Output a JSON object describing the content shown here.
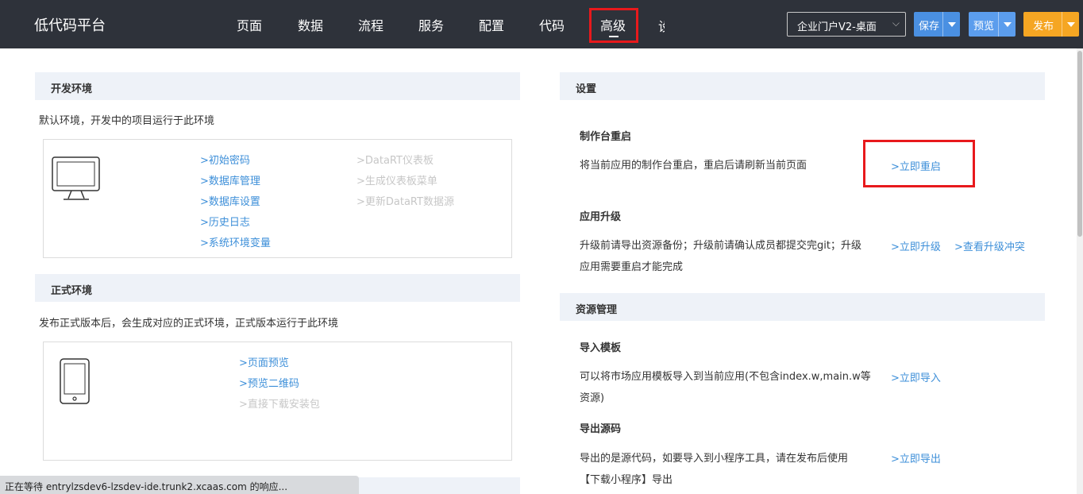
{
  "header": {
    "brand": "低代码平台",
    "nav": [
      "页面",
      "数据",
      "流程",
      "服务",
      "配置",
      "代码",
      "高级"
    ],
    "nav_trunc": "设",
    "env_select": "企业门户V2-桌面",
    "save_label": "保存",
    "preview_label": "预览",
    "publish_label": "发布"
  },
  "dev_env": {
    "title": "开发环境",
    "desc": "默认环境，开发中的项目运行于此环境",
    "links_left": [
      ">初始密码",
      ">数据库管理",
      ">数据库设置",
      ">历史日志",
      ">系统环境变量"
    ],
    "links_right": [
      ">DataRT仪表板",
      ">生成仪表板菜单",
      ">更新DataRT数据源"
    ]
  },
  "prod_env": {
    "title": "正式环境",
    "desc": "发布正式版本后，会生成对应的正式环境，正式版本运行于此环境",
    "links": [
      ">页面预览",
      ">预览二维码",
      ">直接下载安装包"
    ]
  },
  "settings": {
    "title": "设置",
    "restart_title": "制作台重启",
    "restart_desc": "将当前应用的制作台重启，重启后请刷新当前页面",
    "restart_link": ">立即重启",
    "upgrade_title": "应用升级",
    "upgrade_desc_1": "升级前请导出资源备份；升级前请确认成员都提交完git；升级",
    "upgrade_desc_2": "应用需要重启才能完成",
    "upgrade_link": ">立即升级",
    "conflict_link": ">查看升级冲突"
  },
  "resources": {
    "title": "资源管理",
    "import_title": "导入模板",
    "import_desc_1": "可以将市场应用模板导入到当前应用(不包含index.w,main.w等",
    "import_desc_2": "资源)",
    "import_link": ">立即导入",
    "export_title": "导出源码",
    "export_desc_1": "导出的是源代码，如要导入到小程序工具，请在发布后使用",
    "export_desc_2": "【下载小程序】导出",
    "export_link": ">立即导出"
  },
  "status_bar": "正在等待 entrylzsdev6-lzsdev-ide.trunk2.xcaas.com 的响应...",
  "colors": {
    "topbar": "#2e323a",
    "save": "#4a90e2",
    "preview": "#5b9ded",
    "publish": "#f5a623",
    "link": "#3d8fd9",
    "highlight": "#e8191c"
  }
}
